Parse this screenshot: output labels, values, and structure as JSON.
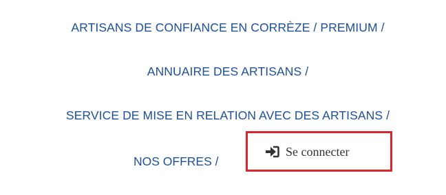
{
  "nav": {
    "items": [
      {
        "label": "ARTISANS DE CONFIANCE EN CORRÈZE / PREMIUM /"
      },
      {
        "label": "ANNUAIRE DES ARTISANS /"
      },
      {
        "label": "SERVICE DE MISE EN RELATION AVEC DES ARTISANS /"
      },
      {
        "label": "NOS OFFRES /"
      }
    ]
  },
  "login": {
    "label": "Se connecter",
    "icon": "sign-in-icon"
  },
  "colors": {
    "link": "#1d4f9a",
    "highlight": "#d8262c",
    "login_text": "#333333"
  }
}
